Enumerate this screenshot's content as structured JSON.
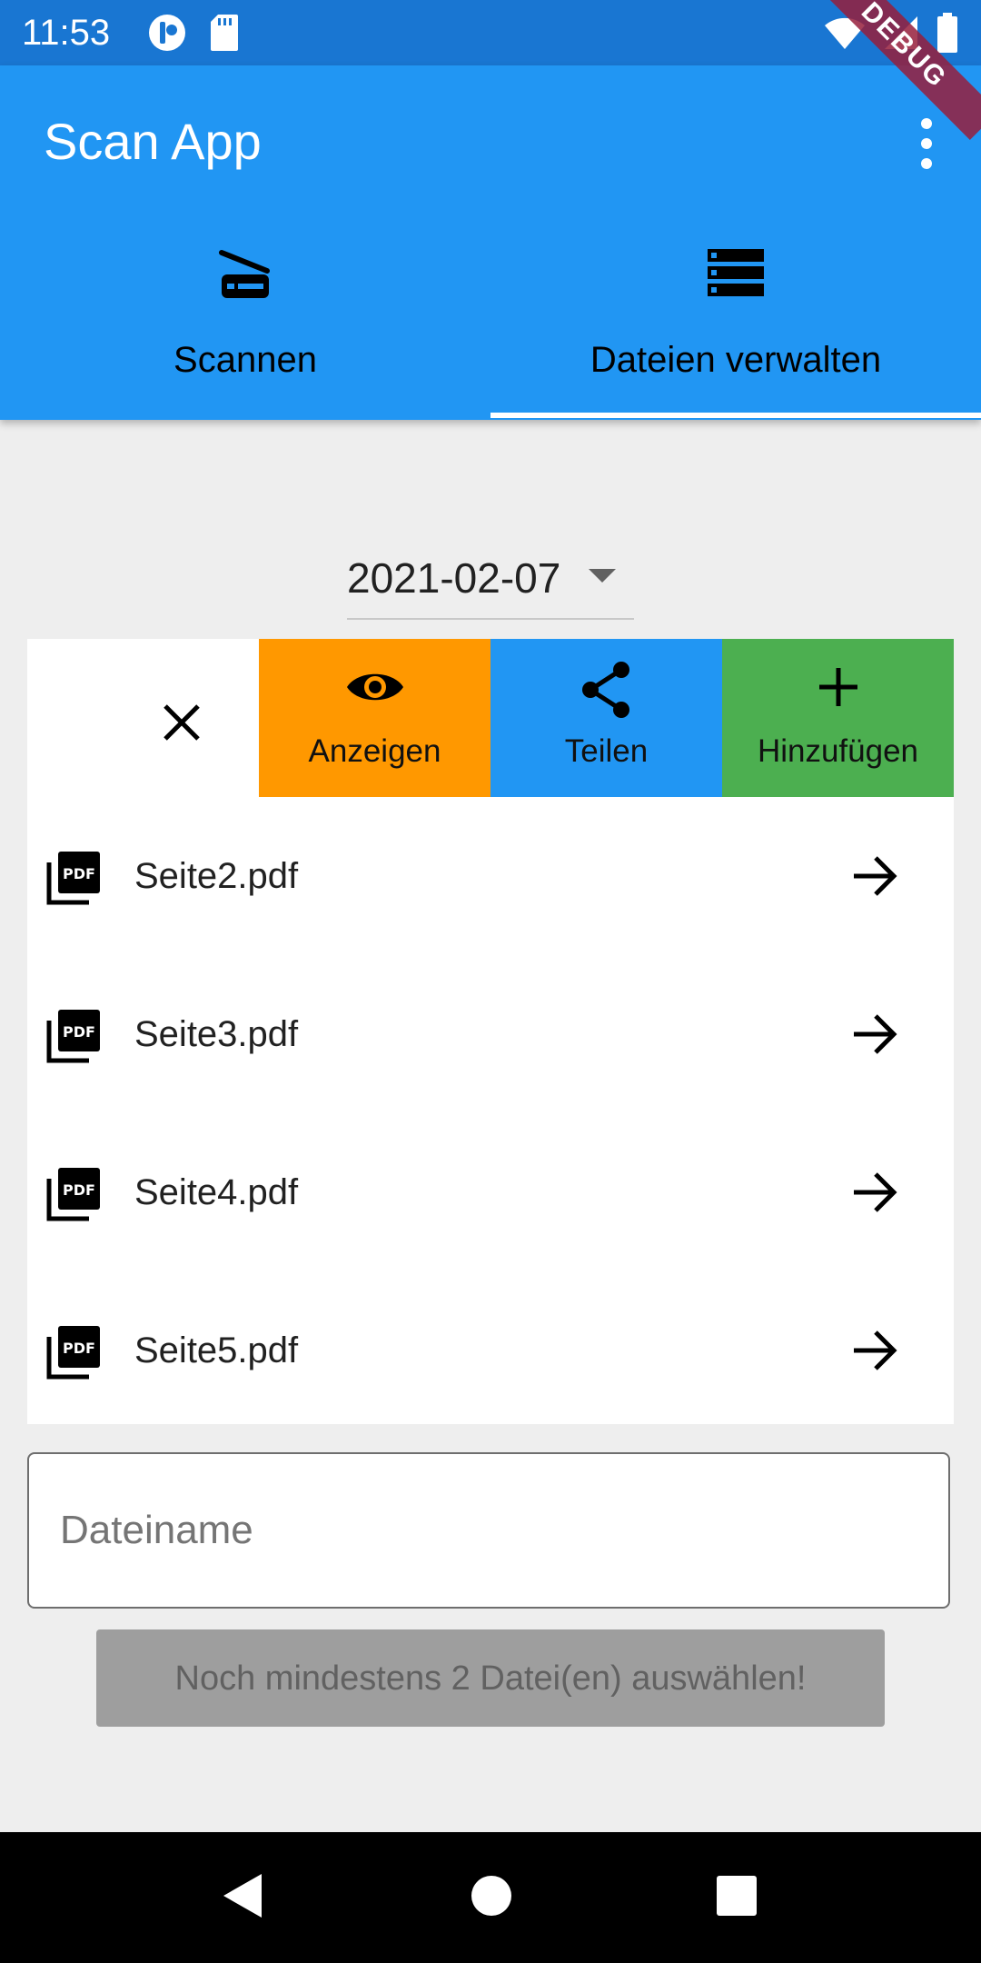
{
  "status_bar": {
    "time": "11:53"
  },
  "debug_banner": "DEBUG",
  "app_bar": {
    "title": "Scan App"
  },
  "tabs": [
    {
      "label": "Scannen",
      "icon": "scanner-icon"
    },
    {
      "label": "Dateien verwalten",
      "icon": "storage-icon"
    }
  ],
  "date_selector": {
    "value": "2021-02-07"
  },
  "actions": [
    {
      "label": "",
      "icon": "close-icon",
      "color": "#ffffff"
    },
    {
      "label": "Anzeigen",
      "icon": "eye-icon",
      "color": "#ff9800"
    },
    {
      "label": "Teilen",
      "icon": "share-icon",
      "color": "#2196f3"
    },
    {
      "label": "Hinzufügen",
      "icon": "plus-icon",
      "color": "#4caf50"
    }
  ],
  "files": [
    {
      "name": "Seite2.pdf"
    },
    {
      "name": "Seite3.pdf"
    },
    {
      "name": "Seite4.pdf"
    },
    {
      "name": "Seite5.pdf"
    }
  ],
  "filename_field": {
    "placeholder": "Dateiname",
    "value": ""
  },
  "submit_button": {
    "label": "Noch mindestens 2 Datei(en) auswählen!"
  },
  "colors": {
    "primary": "#2196f3",
    "primary_dark": "#1976d2",
    "disabled_button": "#9e9e9e"
  }
}
